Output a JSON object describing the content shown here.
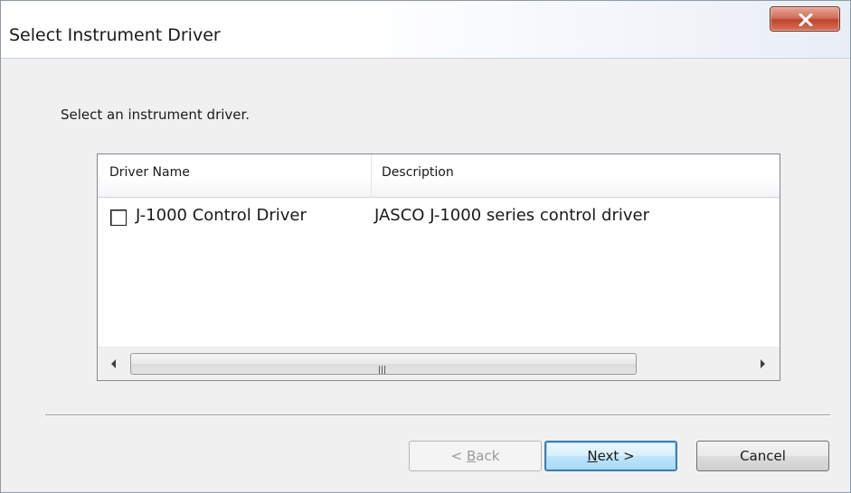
{
  "window": {
    "title": "Select Instrument Driver",
    "close_icon": "close-icon"
  },
  "prompt": "Select an instrument driver.",
  "list": {
    "columns": [
      "Driver Name",
      "Description"
    ],
    "rows": [
      {
        "checked": false,
        "name": "J-1000 Control Driver",
        "description": "JASCO J-1000 series control driver"
      }
    ],
    "scroll_grip": "III"
  },
  "buttons": {
    "back": {
      "prefix": "< ",
      "mnemonic": "B",
      "rest": "ack",
      "enabled": false
    },
    "next": {
      "mnemonic": "N",
      "rest": "ext >",
      "default": true
    },
    "cancel": "Cancel"
  },
  "colors": {
    "close": "#c9452c",
    "default_button_border": "#3c7fb1",
    "window_bg": "#f0f0f0"
  }
}
